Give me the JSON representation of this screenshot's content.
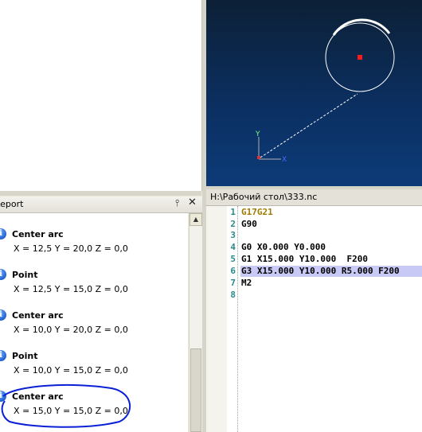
{
  "report": {
    "title": "Report",
    "items": [
      {
        "title": "Center arc",
        "coords": "X = 12,5 Y = 20,0 Z = 0,0"
      },
      {
        "title": "Point",
        "coords": "X = 12,5 Y = 15,0 Z = 0,0"
      },
      {
        "title": "Center arc",
        "coords": "X = 10,0 Y = 20,0 Z = 0,0"
      },
      {
        "title": "Point",
        "coords": "X = 10,0 Y = 15,0 Z = 0,0"
      },
      {
        "title": "Center arc",
        "coords": "X = 15,0 Y = 15,0 Z = 0,0"
      }
    ],
    "pin_icon": "pin-icon",
    "close_icon": "close-icon",
    "info_icon": "info-icon"
  },
  "viewport": {
    "axis_y": "Y",
    "axis_x": "X",
    "background": "#0b3063",
    "marker_color": "#ff1a1a"
  },
  "editor": {
    "title": "H:\\Рабочий стол\\333.nc",
    "lines": [
      {
        "num": "1",
        "text": "G17G21"
      },
      {
        "num": "2",
        "text": "G90"
      },
      {
        "num": "3",
        "text": ""
      },
      {
        "num": "4",
        "text": "G0 X0.000 Y0.000"
      },
      {
        "num": "5",
        "text": "G1 X15.000 Y10.000  F200"
      },
      {
        "num": "6",
        "text": "G3 X15.000 Y10.000 R5.000 F200"
      },
      {
        "num": "7",
        "text": "M2"
      },
      {
        "num": "8",
        "text": ""
      }
    ]
  }
}
